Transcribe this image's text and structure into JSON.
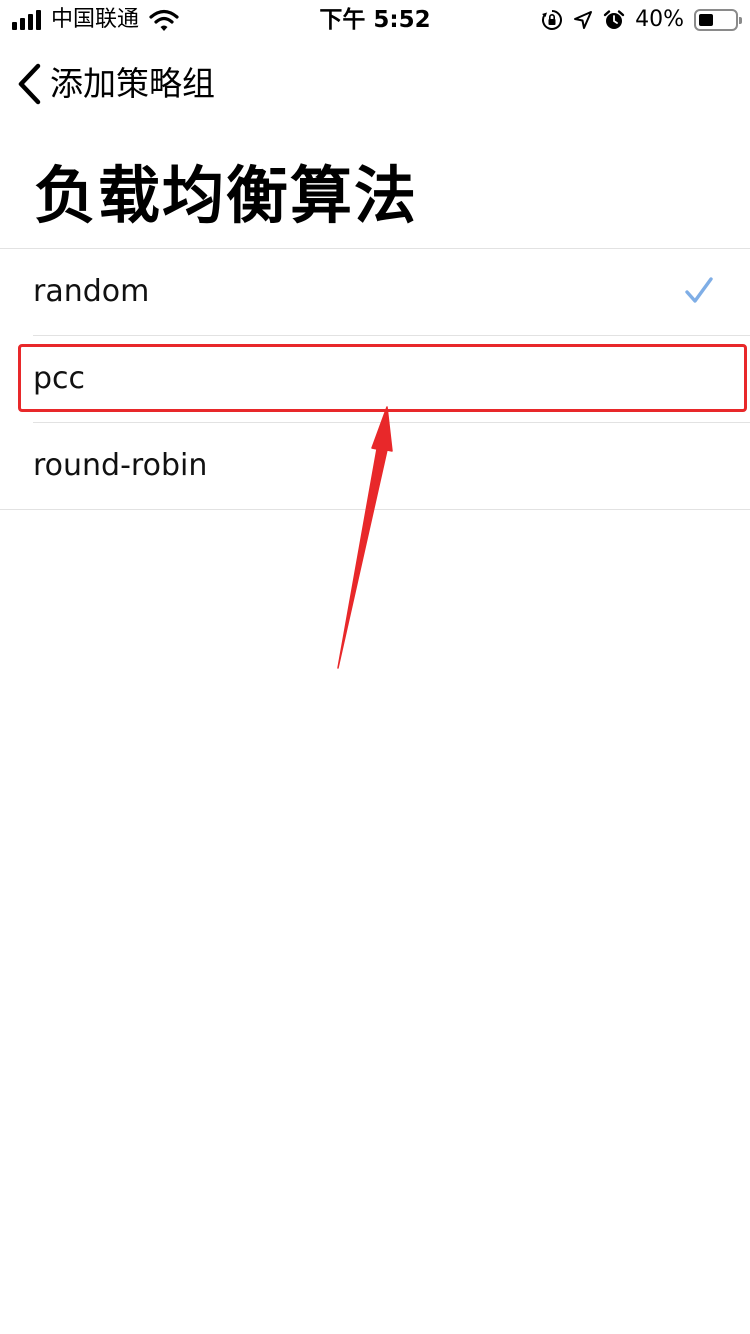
{
  "status_bar": {
    "carrier": "中国联通",
    "time": "下午 5:52",
    "battery_percent": "40%",
    "battery_level": 0.4,
    "icons": [
      "signal-icon",
      "wifi-icon",
      "orientation-lock-icon",
      "location-icon",
      "alarm-icon",
      "battery-icon"
    ]
  },
  "nav": {
    "back_label": "添加策略组"
  },
  "page": {
    "title": "负载均衡算法"
  },
  "options": [
    {
      "label": "random",
      "selected": true
    },
    {
      "label": "pcc",
      "selected": false,
      "highlighted": true
    },
    {
      "label": "round-robin",
      "selected": false
    }
  ],
  "colors": {
    "checkmark": "#7faee6",
    "annotation": "#e8282a",
    "separator": "#e2e2e2"
  }
}
